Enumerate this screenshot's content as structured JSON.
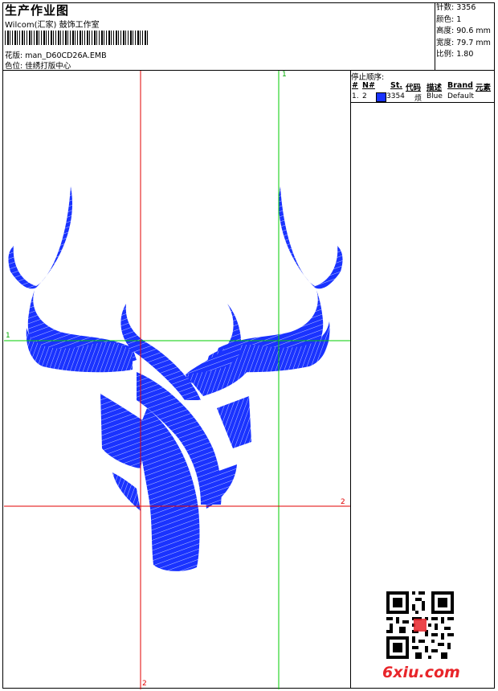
{
  "header": {
    "title": "生产作业图",
    "software": "Wilcom(汇家) 鼓饰工作室",
    "design_label": "花版:",
    "design_value": "man_D60CD26A.EMB",
    "color_label": "色位:",
    "color_value": "佳绣打版中心"
  },
  "stats": {
    "stitches": "针数: 3356",
    "colors": "颜色: 1",
    "height": "高度: 90.6 mm",
    "width": "宽度: 79.7 mm",
    "scale": "比例: 1.80"
  },
  "stop_sequence": {
    "title": "停止顺序:",
    "headers": [
      "#",
      "N#",
      "St.",
      "代码",
      "描述",
      "Brand",
      "元素"
    ],
    "rows": [
      {
        "num": "1.",
        "needle": "2",
        "stitches": "3354",
        "code": "烦",
        "desc": "Blue",
        "brand": "Default",
        "element": "",
        "color": "#1a33ff"
      }
    ]
  },
  "guides": {
    "top_label": "1",
    "left_label": "1",
    "right_label": "2",
    "bottom_label": "2"
  },
  "colors": {
    "thread": "#1a33ff",
    "guide_green": "#00cc00",
    "guide_red": "#e00000",
    "watermark": "#e8252a"
  },
  "watermark": {
    "text": "6xiu.com"
  }
}
